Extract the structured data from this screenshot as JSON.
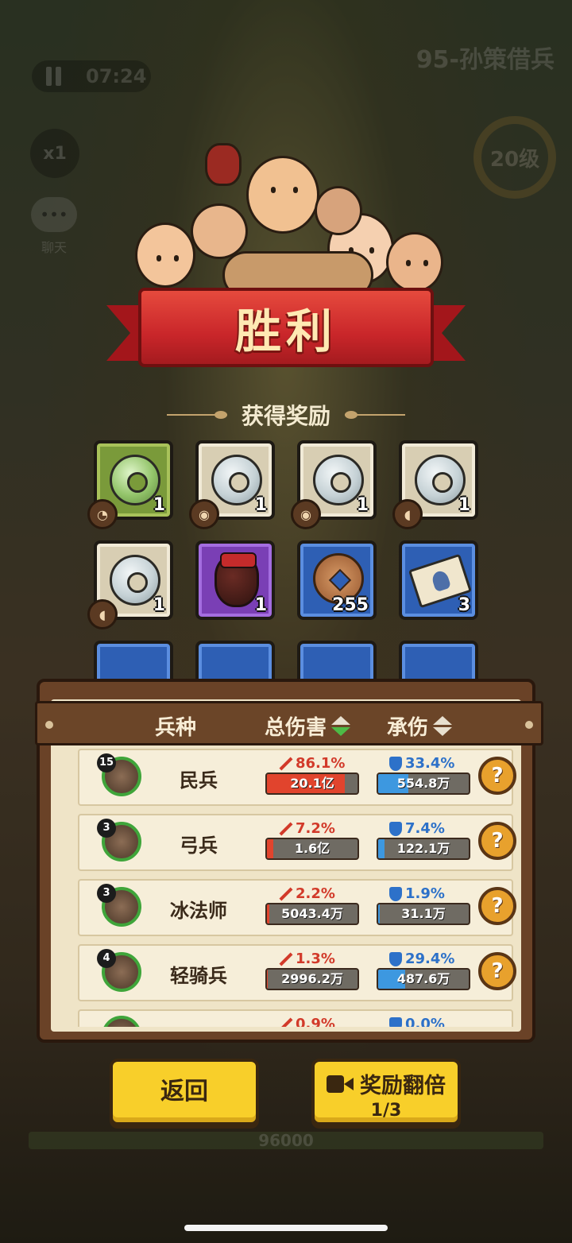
{
  "hud": {
    "timer": "07:24",
    "stage": "95-孙策借兵",
    "speed": "x1",
    "level": "20级",
    "chat_label": "聊天",
    "base_hp": "96000"
  },
  "result": {
    "title": "胜利",
    "rewards_title": "获得奖励"
  },
  "rewards": [
    {
      "type": "jade-disc",
      "tier": "green",
      "count": "1",
      "has_badge": true
    },
    {
      "type": "silver-disc",
      "tier": "white",
      "count": "1",
      "has_badge": true
    },
    {
      "type": "silver-disc",
      "tier": "white",
      "count": "1",
      "has_badge": true
    },
    {
      "type": "silver-disc",
      "tier": "white",
      "count": "1",
      "has_badge": true
    },
    {
      "type": "silver-disc",
      "tier": "white",
      "count": "1",
      "has_badge": true
    },
    {
      "type": "wine-jar",
      "tier": "purple",
      "count": "1",
      "has_badge": false
    },
    {
      "type": "copper-coin",
      "tier": "blue",
      "count": "255",
      "has_badge": false
    },
    {
      "type": "scroll",
      "tier": "blue",
      "count": "3",
      "has_badge": false
    }
  ],
  "stats": {
    "headers": {
      "unit": "兵种",
      "damage": "总伤害",
      "taken": "承伤"
    },
    "rows": [
      {
        "level": "15",
        "name": "民兵",
        "dmg_pct": "86.1%",
        "dmg_val": "20.1亿",
        "dmg_fill": 0.861,
        "def_pct": "33.4%",
        "def_val": "554.8万",
        "def_fill": 0.334
      },
      {
        "level": "3",
        "name": "弓兵",
        "dmg_pct": "7.2%",
        "dmg_val": "1.6亿",
        "dmg_fill": 0.072,
        "def_pct": "7.4%",
        "def_val": "122.1万",
        "def_fill": 0.074
      },
      {
        "level": "3",
        "name": "冰法师",
        "dmg_pct": "2.2%",
        "dmg_val": "5043.4万",
        "dmg_fill": 0.022,
        "def_pct": "1.9%",
        "def_val": "31.1万",
        "def_fill": 0.019
      },
      {
        "level": "4",
        "name": "轻骑兵",
        "dmg_pct": "1.3%",
        "dmg_val": "2996.2万",
        "dmg_fill": 0.013,
        "def_pct": "29.4%",
        "def_val": "487.6万",
        "def_fill": 0.294
      },
      {
        "level": "",
        "name": "",
        "dmg_pct": "0.9%",
        "dmg_val": "",
        "dmg_fill": 0.009,
        "def_pct": "0.0%",
        "def_val": "",
        "def_fill": 0.0
      }
    ],
    "help_label": "?"
  },
  "buttons": {
    "back": "返回",
    "double": "奖励翻倍",
    "double_count": "1/3"
  },
  "colors": {
    "accent_yellow": "#f8cf2a",
    "banner_red": "#c9262a",
    "damage_red": "#e1442d",
    "defense_blue": "#3d98e0"
  }
}
